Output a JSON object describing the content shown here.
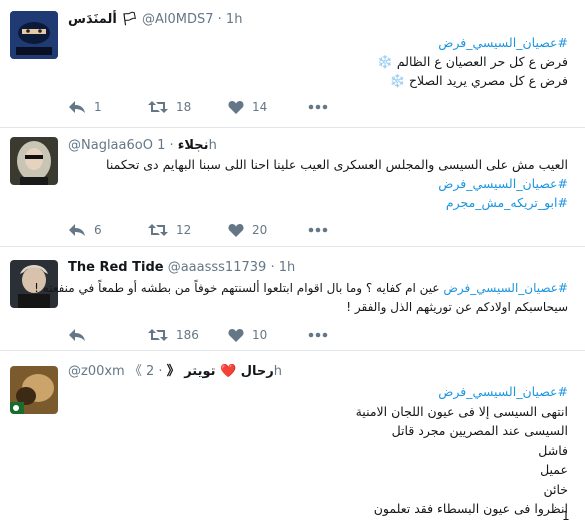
{
  "tweets": [
    {
      "name": "ألمنَدَس 🏳",
      "handle": "@Al0MDS7",
      "time": "· 1h",
      "lines": [
        {
          "tag": "#عصيان_السيسي_فرض",
          "text": ""
        },
        {
          "tag": "",
          "text": "فرض ع كل حر العصيان ع الظالم ❄️"
        },
        {
          "tag": "",
          "text": "فرض ع كل مصري يريد الصلاح ❄️"
        }
      ],
      "reply_count": "1",
      "retweet_count": "18",
      "like_count": "14"
    },
    {
      "name": "نجلاء",
      "handle": "@Naglaa6oO",
      "time": "· 1h",
      "lines": [
        {
          "tag": "",
          "text": "العيب مش على السيسى والمجلس العسكرى العيب علينا احنا اللى سبنا البهايم دى تحكمنا"
        },
        {
          "tag": "#عصيان_السيسي_فرض",
          "text": ""
        },
        {
          "tag": "#ابو_تريكه_مش_مجرم",
          "text": ""
        }
      ],
      "reply_count": "6",
      "retweet_count": "12",
      "like_count": "20"
    },
    {
      "name": "The Red Tide",
      "handle": "@aaasss11739",
      "time": "· 1h",
      "lines": [
        {
          "tag": "#عصيان_السيسي_فرض",
          "text": " عين ام كفايه ؟ وما بال اقوام ابتلعوا ألسنتهم خوفاً من بطشه أو طمعاً في منفعته !"
        },
        {
          "tag": "",
          "text": "سيحاسبكم اولادكم عن توريثهم الذل والفقر !"
        }
      ],
      "reply_count": "",
      "retweet_count": "186",
      "like_count": "10"
    },
    {
      "name": "رحال ❤️ تويتر 《",
      "handle": "@z00xm 《",
      "time": "· 2h",
      "lines": [
        {
          "tag": "#عصيان_السيسي_فرض",
          "text": ""
        },
        {
          "tag": "",
          "text": "انتهى السيسى إلا فى عيون اللجان الامنية"
        },
        {
          "tag": "",
          "text": "السيسى عند المصريين مجرد قاتل"
        },
        {
          "tag": "",
          "text": "فاشل"
        },
        {
          "tag": "",
          "text": "عميل"
        },
        {
          "tag": "",
          "text": "خائن"
        },
        {
          "tag": "",
          "text": "انظروا فى عيون البسطاء فقد تعلمون"
        }
      ],
      "reply_count": "",
      "retweet_count": "",
      "like_count": "",
      "footer_number": "1"
    }
  ],
  "icons": {
    "reply": "reply-icon",
    "retweet": "retweet-icon",
    "like": "heart-icon",
    "more": "more-icon"
  },
  "colors": {
    "hashtag": "#1b95e0",
    "muted": "#657786",
    "divider": "#e1e8ed"
  }
}
